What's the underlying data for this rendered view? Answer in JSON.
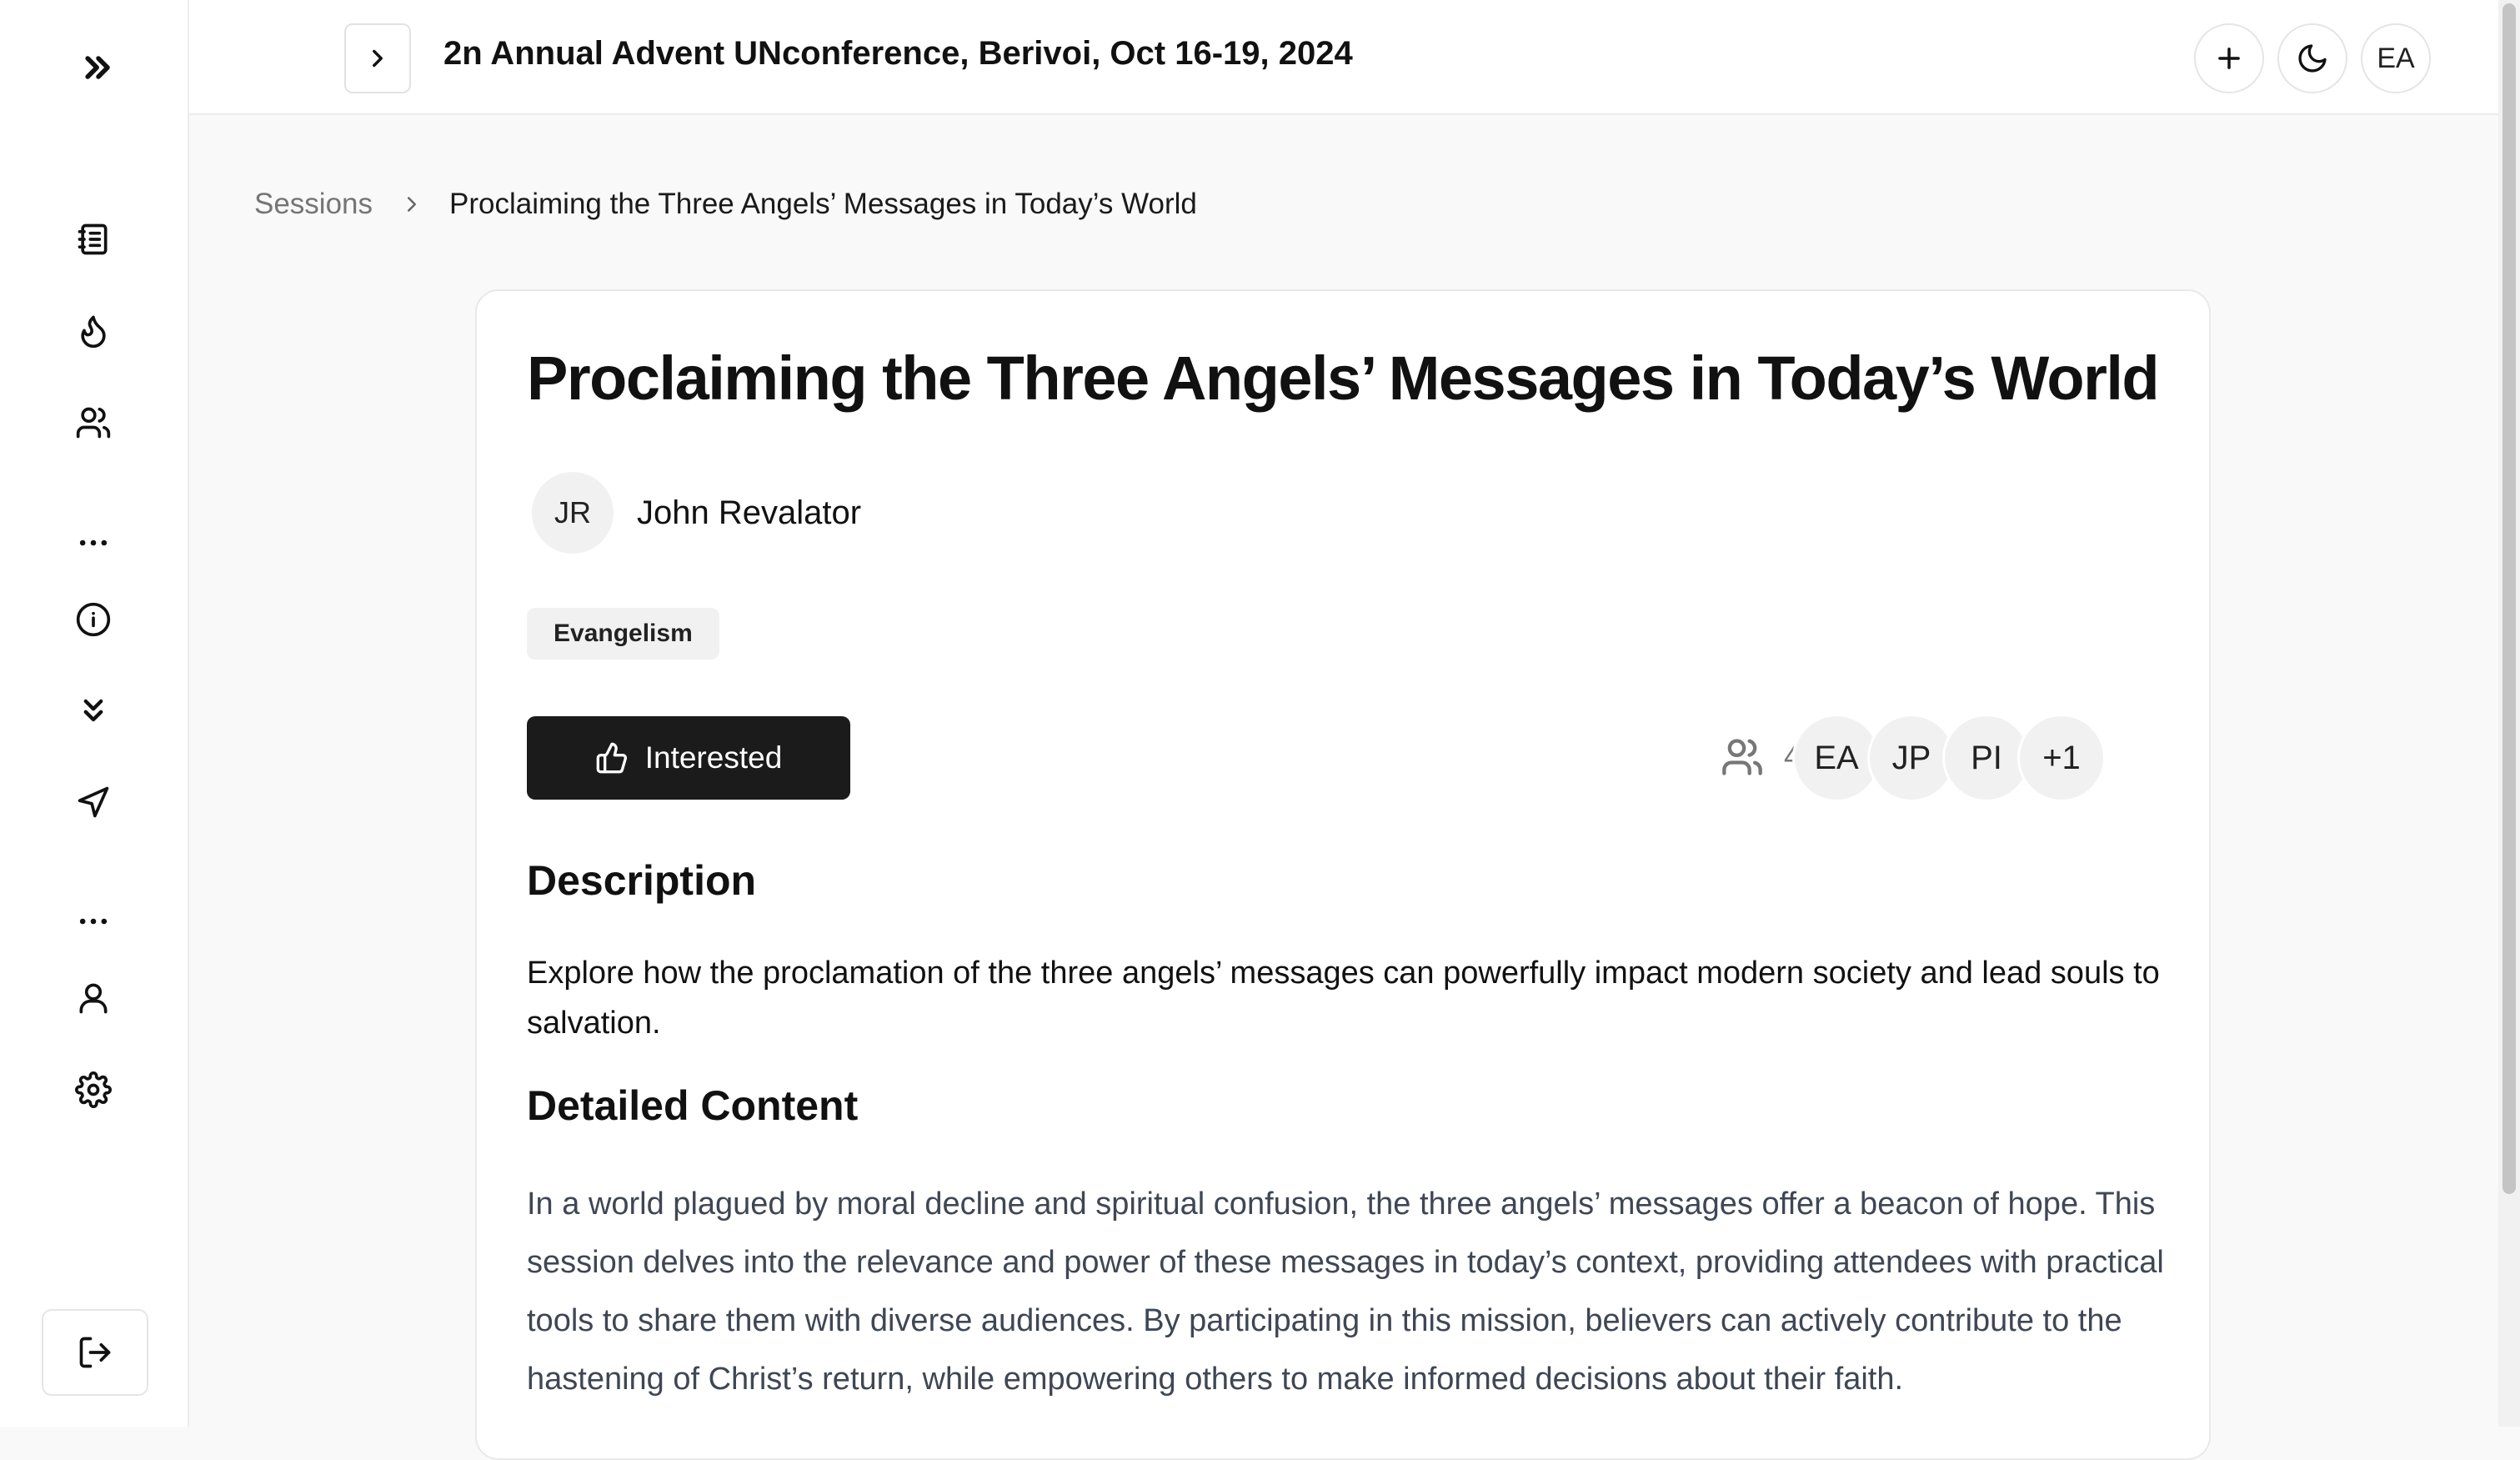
{
  "header": {
    "title": "2n Annual Advent UNconference, Berivoi, Oct 16-19, 2024",
    "user_initials": "EA"
  },
  "sidebar": {
    "items": [
      {
        "icon": "notebook-icon",
        "label": "Sessions"
      },
      {
        "icon": "flame-icon",
        "label": "Trending"
      },
      {
        "icon": "users-icon",
        "label": "People"
      },
      {
        "icon": "more-icon"
      },
      {
        "icon": "info-icon",
        "label": "Info"
      },
      {
        "icon": "chevrons-down-icon"
      },
      {
        "icon": "send-icon"
      },
      {
        "icon": "more-icon"
      },
      {
        "icon": "user-icon",
        "label": "Profile"
      },
      {
        "icon": "settings-icon",
        "label": "Settings"
      }
    ]
  },
  "breadcrumb": {
    "root": "Sessions",
    "current": "Proclaiming the Three Angels’ Messages in Today’s World"
  },
  "session": {
    "title": "Proclaiming the Three Angels’ Messages in Today’s World",
    "speaker": {
      "initials": "JR",
      "name": "John Revalator"
    },
    "tag": "Evangelism",
    "interested_label": "Interested",
    "attendee_count": "4",
    "attendees": [
      "EA",
      "JP",
      "PI",
      "+1"
    ],
    "description_heading": "Description",
    "description": "Explore how the proclamation of the three angels’ messages can powerfully impact modern society and lead souls to salvation.",
    "detailed_heading": "Detailed Content",
    "detailed": "In a world plagued by moral decline and spiritual confusion, the three angels’ messages offer a beacon of hope. This session delves into the relevance and power of these messages in today’s context, providing attendees with practical tools to share them with diverse audiences. By participating in this mission, believers can actively contribute to the hastening of Christ’s return, while empowering others to make informed decisions about their faith."
  },
  "colors": {
    "primary_button": "#1b1b1b",
    "page_background": "#f9f9f9",
    "muted_text": "#757575"
  }
}
